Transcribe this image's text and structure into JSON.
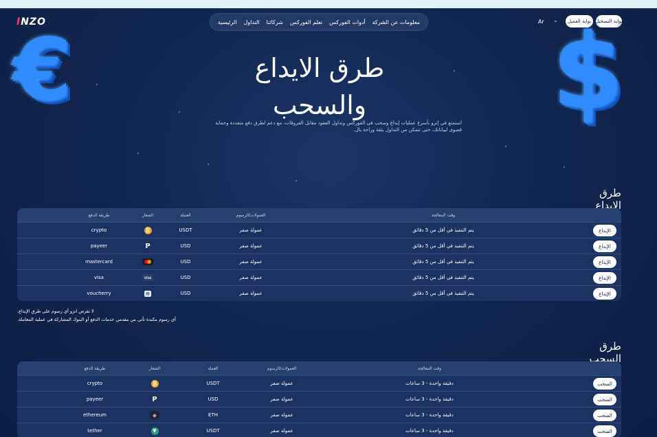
{
  "header": {
    "logo": "INZO",
    "nav_items": [
      "معلومات عن الشركة",
      "أدوات الفوركس",
      "تعلم الفوركس",
      "شركائنا",
      "التداول",
      "الرئيسية"
    ],
    "language": "Ar",
    "register_button": "بوابة التسجيل",
    "client_portal_button": "بوابة العميل"
  },
  "hero": {
    "title_line1": "طرق الايداع",
    "title_line2": "والسحب",
    "description_line1": "استمتع في إنزو بأسرع عمليات إيداع وسحب في الفوركس وتداول العقود مقابل الفروقات، مع دعم لطرق دفع متعددة وحماية",
    "description_line2": "قصوى لبياناتك، حتى تتمكن من التداول بثقة وراحة بال."
  },
  "deposit": {
    "title": "طرق الإيداع",
    "headers": {
      "method": "طريقة الدفع",
      "icon": "الشعار",
      "currency": "العملة",
      "fees": "العمولات/الرسوم",
      "time": "وقت المعالجة"
    },
    "rows": [
      {
        "method": "crypto",
        "icon": "bitcoin-icon",
        "currency": "USDT",
        "fees": "عمولة صفر",
        "time": "يتم التنفيذ في أقل من 5 دقائق",
        "button": "الإيداع"
      },
      {
        "method": "payeer",
        "icon": "payeer-icon",
        "currency": "USD",
        "fees": "عمولة صفر",
        "time": "يتم التنفيذ في أقل من 5 دقائق",
        "button": "الإيداع"
      },
      {
        "method": "mastercard",
        "icon": "mastercard-icon",
        "currency": "USD",
        "fees": "عمولة صفر",
        "time": "يتم التنفيذ في أقل من 5 دقائق",
        "button": "الإيداع"
      },
      {
        "method": "visa",
        "icon": "visa-icon",
        "currency": "USD",
        "fees": "عمولة صفر",
        "time": "يتم التنفيذ في أقل من 5 دقائق",
        "button": "الإيداع"
      },
      {
        "method": "voucherry",
        "icon": "voucherry-icon",
        "currency": "USD",
        "fees": "عمولة صفر",
        "time": "يتم التنفيذ في أقل من 5 دقائق",
        "button": "الإيداع"
      }
    ],
    "note_line1": "لا تفرض انزو أي رسوم على طرق الإيداع.",
    "note_line2": "أي رسوم مكبدة تأتي من مقدمي خدمات الدفع أو البنوك المشاركة في عملية المعاملة."
  },
  "withdrawal": {
    "title": "طرق السحب",
    "headers": {
      "method": "طريقة الدفع",
      "icon": "الشعار",
      "currency": "العملة",
      "fees": "العمولات/الرسوم",
      "time": "وقت المعالجة"
    },
    "rows": [
      {
        "method": "crypto",
        "icon": "bitcoin-icon",
        "currency": "USDT",
        "fees": "عمولة صفر",
        "time": "دقيقة واحدة - 3 ساعات",
        "button": "السحب"
      },
      {
        "method": "payeer",
        "icon": "payeer-icon",
        "currency": "USD",
        "fees": "عمولة صفر",
        "time": "دقيقة واحدة - 3 ساعات",
        "button": "السحب"
      },
      {
        "method": "ethereum",
        "icon": "ethereum-icon",
        "currency": "ETH",
        "fees": "عمولة صفر",
        "time": "دقيقة واحدة - 3 ساعات",
        "button": "السحب"
      },
      {
        "method": "tether",
        "icon": "tether-icon",
        "currency": "USDT",
        "fees": "عمولة صفر",
        "time": "دقيقة واحدة - 3 ساعات",
        "button": "السحب"
      }
    ]
  },
  "colors": {
    "background": "#0d2147",
    "table": "#1b3363",
    "accent_blue": "#2f8cff"
  }
}
